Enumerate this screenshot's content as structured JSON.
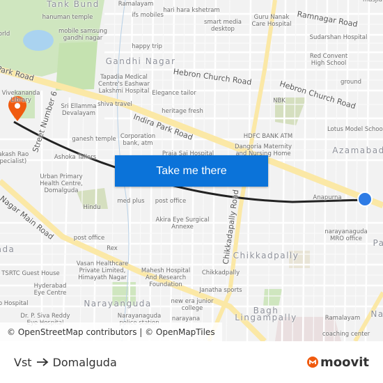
{
  "map": {
    "labels": [
      "Tank Bund",
      "hanuman temple",
      "mobile samsung\ngandhi nagar",
      "ifs mobiles",
      "hari hara kshetram",
      "Ramalayam",
      "happy trip",
      "Gandhi Nagar",
      "Tapadia Medical\nCentre's Eashwar\nLakshmi Hospital",
      "Elegance tailor",
      "shiva travel",
      "Sri Ellamma\nDevalayam",
      "heritage fresh",
      "ganesh temple",
      "Corporation\nbank, atm",
      "Vivekananda\nLibrary",
      "Prakash Rao\n(specialist)",
      "Ashoka Tailors",
      "Praja Sai Hospital",
      "Guru Nanak\nCare Hospital",
      "smart media\ndesktop",
      "Sudarshan Hospital",
      "Red Convent\nHigh School",
      "ground",
      "NBK",
      "Lotus Model School",
      "HDFC BANK ATM",
      "Dangoria Maternity\nand Nursing Home",
      "Azamabad",
      "Urban Primary\nHealth Centre,\nDomalguda",
      "Hindu",
      "med plus",
      "post office",
      "Akira Eye Surgical\nAnnexe",
      "post office",
      "Rex",
      "Vasan Healthcare\nPrivate Limited,\nHimayath Nagar",
      "Mahesh Hospital\nAnd Research\nFoundation",
      "TSRTC Guest House",
      "Hyderabad\nEye Centre",
      "Narayanguda",
      "Dr. P. Siva Reddy\nEye Hospital",
      "Narayanaguda\npolice station",
      "new era junior\ncollege",
      "Anapurna",
      "narayanaguda\nMRO office",
      "Chikkadpally",
      "Chikkadpally",
      "Janatha sports",
      "Bagh\nLingampally",
      "Ramalayam",
      "coaching center",
      "masjid",
      "orld",
      "ada",
      "Pa",
      "Na",
      "lo Hospital",
      "narayana"
    ],
    "roads": [
      "Park Road",
      "Indira Park Road",
      "Street Number 6",
      "Hebron Church Road",
      "Hebron Church Road",
      "Ramnagar Road",
      "Nagar Main Road",
      "Chikkadapally Road"
    ],
    "attribution": "© OpenStreetMap contributors | © OpenMapTiles",
    "route_color": "#222222",
    "origin_marker_color": "#2d7be5",
    "destination_marker_color": "#f05a0e"
  },
  "button": {
    "label": "Take me there",
    "color": "#0b73d9"
  },
  "footer": {
    "origin": "Vst",
    "destination": "Domalguda",
    "logo": "moovit",
    "logo_color": "#f05a0e"
  }
}
